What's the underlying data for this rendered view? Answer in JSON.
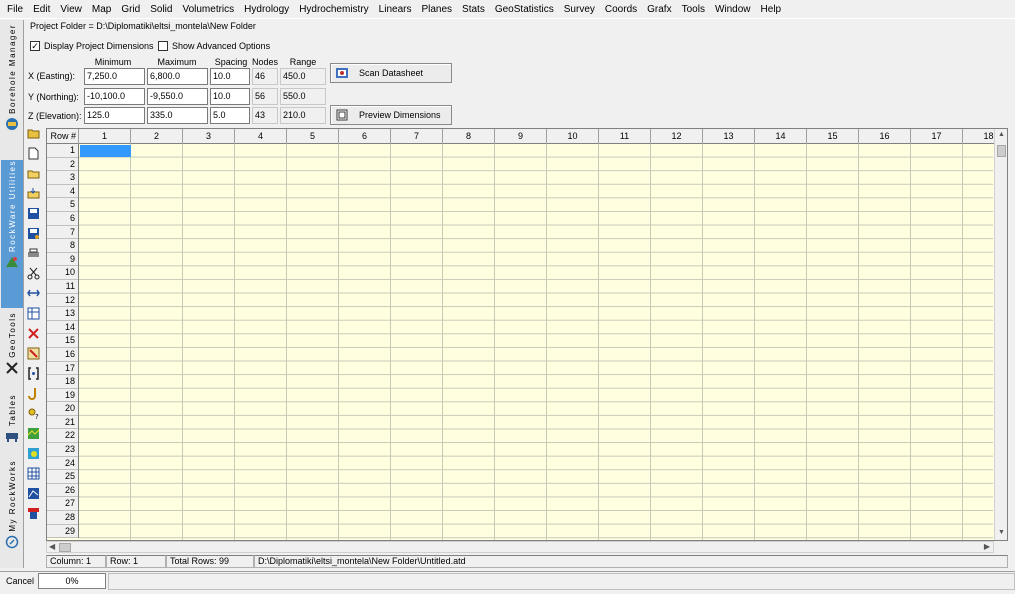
{
  "menu": [
    "File",
    "Edit",
    "View",
    "Map",
    "Grid",
    "Solid",
    "Volumetrics",
    "Hydrology",
    "Hydrochemistry",
    "Linears",
    "Planes",
    "Stats",
    "GeoStatistics",
    "Survey",
    "Coords",
    "Grafx",
    "Tools",
    "Window",
    "Help"
  ],
  "tabs": {
    "borehole": "Borehole Manager",
    "rockworks": "RockWare Utilities",
    "geotools": "GeoTools",
    "tables": "Tables",
    "myrockworks": "My RockWorks"
  },
  "project_path": "Project Folder = D:\\Diplomatiki\\eltsi_montela\\New Folder",
  "options": {
    "display_dimensions": {
      "label": "Display Project Dimensions",
      "checked": true
    },
    "show_advanced": {
      "label": "Show Advanced Options",
      "checked": false
    }
  },
  "dims": {
    "headers": {
      "minimum": "Minimum",
      "maximum": "Maximum",
      "spacing": "Spacing",
      "nodes": "Nodes",
      "range": "Range"
    },
    "rows": [
      {
        "label": "X (Easting):",
        "min": "7,250.0",
        "max": "6,800.0",
        "spacing": "10.0",
        "nodes": "46",
        "range": "450.0"
      },
      {
        "label": "Y (Northing):",
        "min": "-10,100.0",
        "max": "-9,550.0",
        "spacing": "10.0",
        "nodes": "56",
        "range": "550.0"
      },
      {
        "label": "Z (Elevation):",
        "min": "125.0",
        "max": "335.0",
        "spacing": "5.0",
        "nodes": "43",
        "range": "210.0"
      }
    ]
  },
  "buttons": {
    "scan": "Scan Datasheet",
    "preview": "Preview Dimensions"
  },
  "sheet": {
    "corner": "Row #",
    "columns": [
      "1",
      "2",
      "3",
      "4",
      "5",
      "6",
      "7",
      "8",
      "9",
      "10",
      "11",
      "12",
      "13",
      "14",
      "15",
      "16",
      "17",
      "18"
    ],
    "rows": [
      "1",
      "2",
      "3",
      "4",
      "5",
      "6",
      "7",
      "8",
      "9",
      "10",
      "11",
      "12",
      "13",
      "14",
      "15",
      "16",
      "17",
      "18",
      "19",
      "20",
      "21",
      "22",
      "23",
      "24",
      "25",
      "26",
      "27",
      "28",
      "29"
    ]
  },
  "status": {
    "column": "Column: 1",
    "row": "Row: 1",
    "total": "Total Rows: 99",
    "file": "D:\\Diplomatiki\\eltsi_montela\\New Folder\\Untitled.atd"
  },
  "bottom": {
    "cancel": "Cancel",
    "progress": "0%"
  },
  "colors": {
    "selection": "#3399ff",
    "sheet_bg": "#ffffe0",
    "active_tab": "#5b9bd5"
  }
}
